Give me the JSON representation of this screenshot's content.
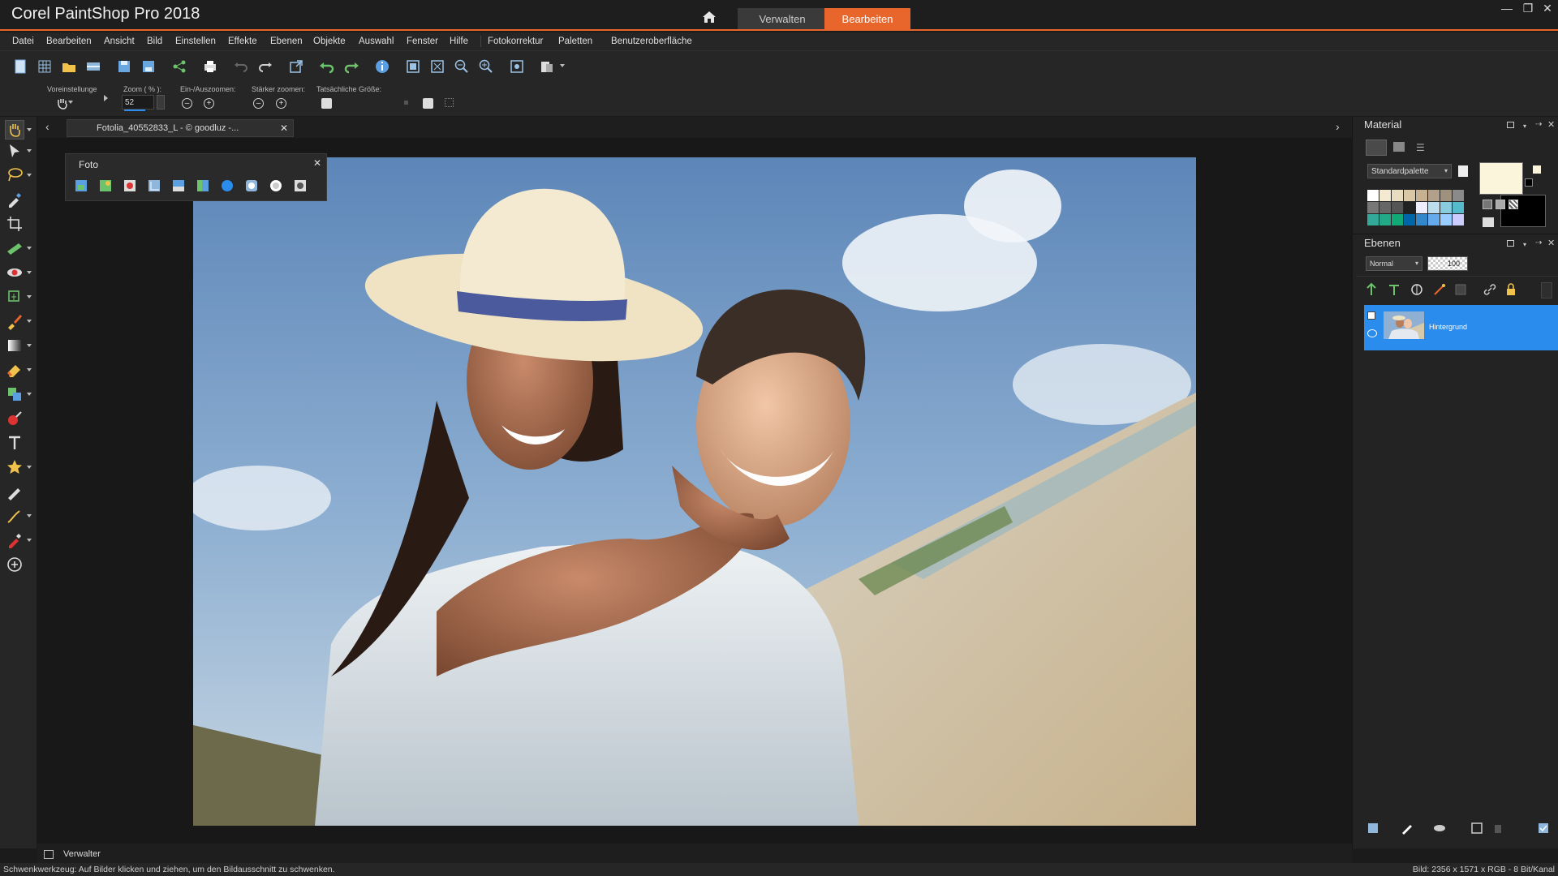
{
  "app": {
    "title": "Corel PaintShop Pro 2018",
    "home_icon": "home-icon",
    "modes": [
      "Verwalten",
      "Bearbeiten"
    ],
    "active_mode": "Bearbeiten",
    "accent_color": "#e8662b"
  },
  "menu": [
    "Datei",
    "Bearbeiten",
    "Ansicht",
    "Bild",
    "Einstellen",
    "Effekte",
    "Ebenen",
    "Objekte",
    "Auswahl",
    "Fenster",
    "Hilfe",
    "Fotokorrektur",
    "Paletten",
    "Benutzeroberfläche"
  ],
  "options": {
    "preset_label": "Voreinstellunge",
    "zoom_label": "Zoom ( % ):",
    "zoom_value": "52",
    "zoom_inout_label": "Ein-/Auszoomen:",
    "zoom_more_label": "Stärker zoomen:",
    "actual_size_label": "Tatsächliche Größe:"
  },
  "document": {
    "tab_title": "Fotolia_40552833_L - © goodluz -..."
  },
  "foto_palette": {
    "title": "Foto"
  },
  "material": {
    "title": "Material",
    "palette_select": "Standardpalette",
    "foreground_color": "#fbf5dc",
    "background_color": "#000000"
  },
  "layers": {
    "title": "Ebenen",
    "blend_mode": "Normal",
    "opacity": "100",
    "items": [
      {
        "name": "Hintergrund",
        "selected": true
      }
    ],
    "selected_color": "#2a8cec"
  },
  "bottom_tab": {
    "label": "Verwalter"
  },
  "status": {
    "left": "Schwenkwerkzeug: Auf Bilder klicken und ziehen, um den Bildausschnitt zu schwenken.",
    "right": "Bild:  2356 x 1571 x RGB - 8 Bit/Kanal"
  }
}
